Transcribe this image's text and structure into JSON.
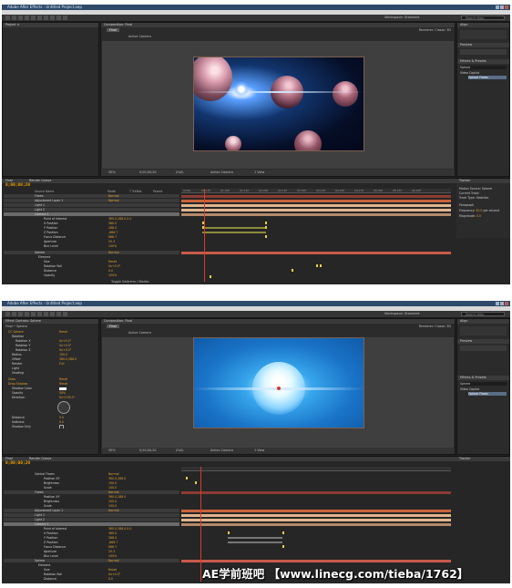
{
  "app": {
    "title": "Adobe After Effects - Untitled Project.aep",
    "menu": [
      "File",
      "Edit",
      "Composition",
      "Layer",
      "Effect",
      "Animation",
      "View",
      "Window",
      "Help"
    ],
    "workspace_label": "Workspace:",
    "workspace_value": "Standard",
    "search_placeholder": "Search Help"
  },
  "shot1": {
    "project_panel_title": "Project  ×",
    "comp_tab": "Composition: Final",
    "comp_sub_tab": "Final",
    "active_camera": "Active Camera",
    "renderer": "Renderer:  Classic 3D",
    "viewer_zoom": "50%",
    "viewer_time": "0;00;00;20",
    "viewer_res": "(Full)",
    "viewer_view": "Active Camera",
    "viewer_views": "1 View",
    "timeline_tab": "Final",
    "render_queue_tab": "Render Queue",
    "timecode": "0;00;00;20",
    "col_source": "Source Name",
    "col_mode": "Mode",
    "col_trkmat": "T TrkMat",
    "col_parent": "Parent",
    "toggle_label": "Toggle Switches / Modes",
    "ruler": [
      "0:00s",
      "00:15f",
      "01:00f",
      "01:15f",
      "02:00f",
      "02:15f",
      "03:00f",
      "03:15f",
      "04:00f",
      "04:15f",
      "05:00f",
      "05:15f",
      "06:00f"
    ],
    "layers": [
      {
        "num": "1",
        "name": "Flares",
        "val": "Normal"
      },
      {
        "num": "2",
        "name": "Adjustment Layer 1",
        "val": "Normal"
      },
      {
        "num": "3",
        "name": "Light 1",
        "val": ""
      },
      {
        "num": "4",
        "name": "Light 2",
        "val": ""
      },
      {
        "num": "5",
        "name": "Camera 1",
        "val": ""
      },
      {
        "num": "",
        "name": "Point of Interest",
        "val": "360.0,288.0,0.0"
      },
      {
        "num": "",
        "name": "X Position",
        "val": "360.0"
      },
      {
        "num": "",
        "name": "Y Position",
        "val": "288.0"
      },
      {
        "num": "",
        "name": "Z Position",
        "val": "-666.7"
      },
      {
        "num": "",
        "name": "Focus Distance",
        "val": "666.7"
      },
      {
        "num": "",
        "name": "Aperture",
        "val": "25.3"
      },
      {
        "num": "",
        "name": "Blur Level",
        "val": "100%"
      },
      {
        "num": "6",
        "name": "Sphere",
        "val": "Normal"
      },
      {
        "num": "",
        "name": "Element",
        "val": ""
      },
      {
        "num": "",
        "name": "Size",
        "val": "Reset"
      },
      {
        "num": "",
        "name": "Rotation Roll",
        "val": "0x+0.0°"
      },
      {
        "num": "",
        "name": "Distance",
        "val": "0.0"
      },
      {
        "num": "",
        "name": "Opacity",
        "val": "100%"
      }
    ],
    "effects_panel_title": "Effects & Presets",
    "effects_search": "Sphere",
    "effects_result": "Video Copilot",
    "effects_item": "Optical Flares",
    "align_title": "Align",
    "preview_title": "Preview",
    "paragraph_title": "Paragraph",
    "character_title": "Character",
    "paint_title": "Paint",
    "tracker_title": "Tracker",
    "motion_source": "Motion Source:",
    "motion_source_value": "Sphere",
    "current_track": "Current Track:",
    "track_type": "Track Type:",
    "track_type_value": "Stabilize",
    "frequency_label": "Frequency:",
    "frequency_value": "50.0",
    "frequency_unit": "per second",
    "magnitude_label": "Magnitude:",
    "magnitude_value": "0.0"
  },
  "shot2": {
    "effect_controls_title": "Effect Controls: Sphere",
    "layer_label": "Final • Sphere",
    "effects": [
      {
        "name": "CC Sphere",
        "val": "Reset"
      },
      {
        "name": "Rotation",
        "val": ""
      },
      {
        "name": "Rotation X",
        "val": "0x+0.0°"
      },
      {
        "name": "Rotation Y",
        "val": "0x+0.0°"
      },
      {
        "name": "Rotation Z",
        "val": "0x+0.0°"
      },
      {
        "name": "Radius",
        "val": "150.0"
      },
      {
        "name": "Offset",
        "val": "360.0,288.0"
      },
      {
        "name": "Render",
        "val": "Full"
      },
      {
        "name": "Light",
        "val": ""
      },
      {
        "name": "Shading",
        "val": ""
      },
      {
        "name": "Glow",
        "val": "Reset"
      },
      {
        "name": "Drop Shadow",
        "val": "Reset"
      },
      {
        "name": "Shadow Color",
        "val": ""
      },
      {
        "name": "Opacity",
        "val": "50%"
      },
      {
        "name": "Direction",
        "val": "0x+135.0°"
      },
      {
        "name": "Distance",
        "val": "5.0"
      },
      {
        "name": "Softness",
        "val": "0.0"
      },
      {
        "name": "Shadow Only",
        "val": ""
      }
    ],
    "timecode": "0;00;00;20",
    "layers": [
      {
        "name": "Optical Flares",
        "val": "Normal"
      },
      {
        "name": "Position XY",
        "val": "360.0,288.0"
      },
      {
        "name": "Brightness",
        "val": "100.0"
      },
      {
        "name": "Scale",
        "val": "100.0"
      },
      {
        "name": "Flares",
        "val": "Normal"
      },
      {
        "name": "Position XY",
        "val": "360.0,288.0"
      },
      {
        "name": "Brightness",
        "val": "100.0"
      },
      {
        "name": "Scale",
        "val": "100.0"
      },
      {
        "name": "Adjustment Layer 1",
        "val": "Normal"
      },
      {
        "name": "Light 1",
        "val": ""
      },
      {
        "name": "Light 2",
        "val": ""
      },
      {
        "name": "Camera 1",
        "val": ""
      },
      {
        "name": "Point of Interest",
        "val": "360.0,288.0,0.0"
      },
      {
        "name": "X Position",
        "val": "360.0"
      },
      {
        "name": "Y Position",
        "val": "288.0"
      },
      {
        "name": "Z Position",
        "val": "-666.7"
      },
      {
        "name": "Focus Distance",
        "val": "666.7"
      },
      {
        "name": "Aperture",
        "val": "25.3"
      },
      {
        "name": "Blur Level",
        "val": "100%"
      },
      {
        "name": "Sphere",
        "val": "Normal"
      },
      {
        "name": "Element",
        "val": ""
      },
      {
        "name": "Size",
        "val": "Reset"
      },
      {
        "name": "Rotation Roll",
        "val": "0x+0.0°"
      },
      {
        "name": "Distance",
        "val": "0.0"
      },
      {
        "name": "Animation",
        "val": ""
      }
    ]
  },
  "watermark": "AE学前班吧  【www.linecg.com/tieba/1762】",
  "colors": {
    "accent_timecode": "#f0a000",
    "cti": "#d63b2a",
    "keyframe": "#e8d040",
    "layer_orange": "#c9643c",
    "layer_peach": "#e0b48e",
    "layer_tan": "#b58a6a",
    "titlebar": "#2e4a6b",
    "sky_blue": "#37a6ec",
    "night_blue": "#050e26"
  }
}
